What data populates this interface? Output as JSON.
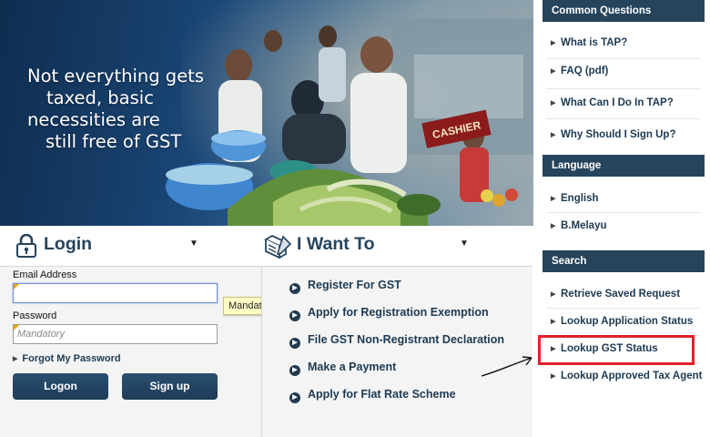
{
  "banner": {
    "line1": "Not everything gets",
    "line2": "taxed, basic",
    "line3": "necessities are",
    "line4": "still free of GST",
    "cashier_sign": "CASHIER"
  },
  "login": {
    "title": "Login",
    "email_label": "Email Address",
    "email_value": "",
    "password_label": "Password",
    "password_placeholder": "Mandatory",
    "tooltip": "Mandatory",
    "forgot_label": "Forgot My Password",
    "logon_label": "Logon",
    "signup_label": "Sign up"
  },
  "want": {
    "title": "I Want To",
    "items": [
      "Register For GST",
      "Apply for Registration Exemption",
      "File GST Non-Registrant Declaration",
      "Make a Payment",
      "Apply for Flat Rate Scheme"
    ]
  },
  "sidebar": {
    "common_questions": {
      "title": "Common Questions",
      "items": [
        "What is TAP?",
        "FAQ (pdf)",
        "What Can I Do In TAP?",
        "Why Should I Sign Up?"
      ]
    },
    "language": {
      "title": "Language",
      "items": [
        "English",
        "B.Melayu"
      ]
    },
    "search": {
      "title": "Search",
      "items": [
        "Retrieve Saved Request",
        "Lookup Application Status",
        "Lookup GST Status",
        "Lookup Approved Tax Agent"
      ]
    }
  },
  "colors": {
    "header_bg": "#26445c",
    "link_text": "#1d3a52",
    "button_bg": "#1d3c58",
    "highlight": "#e2222b",
    "tooltip_bg": "#ffffc6",
    "required_marker": "#f0a500"
  },
  "icons": {
    "login": "lock-icon",
    "want": "form-pencil-icon",
    "list_bullet": "arrow-circle-icon",
    "side_bullet": "triangle-right-icon"
  }
}
